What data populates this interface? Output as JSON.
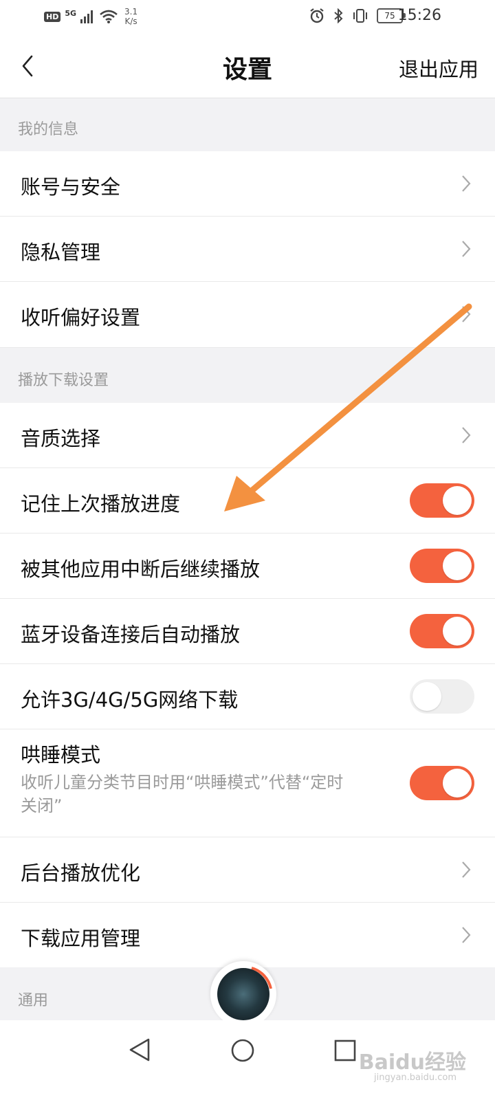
{
  "status_bar": {
    "hd": "HD",
    "signal": "5G",
    "net_speed_value": "3.1",
    "net_speed_unit": "K/s",
    "battery": "75",
    "time": "15:26"
  },
  "header": {
    "title": "设置",
    "exit_label": "退出应用"
  },
  "sections": {
    "my_info": {
      "label": "我的信息",
      "items": [
        {
          "label": "账号与安全"
        },
        {
          "label": "隐私管理"
        },
        {
          "label": "收听偏好设置"
        }
      ]
    },
    "playback": {
      "label": "播放下载设置",
      "quality": {
        "label": "音质选择"
      },
      "remember_progress": {
        "label": "记住上次播放进度",
        "on": true
      },
      "resume_after_interrupt": {
        "label": "被其他应用中断后继续播放",
        "on": true
      },
      "bluetooth_autoplay": {
        "label": "蓝牙设备连接后自动播放",
        "on": true
      },
      "mobile_download": {
        "label": "允许3G/4G/5G网络下载",
        "on": false
      },
      "sleep_mode": {
        "label": "哄睡模式",
        "description": "收听儿童分类节目时用“哄睡模式”代替“定时关闭”",
        "on": true
      },
      "background_opt": {
        "label": "后台播放优化"
      },
      "download_manage": {
        "label": "下载应用管理"
      }
    },
    "general": {
      "label": "通用"
    }
  },
  "watermark": {
    "brand": "Baidu经验",
    "url": "jingyan.baidu.com"
  },
  "colors": {
    "accent": "#f4623e",
    "annotation_arrow": "#f39140",
    "section_bg": "#f2f2f4"
  }
}
